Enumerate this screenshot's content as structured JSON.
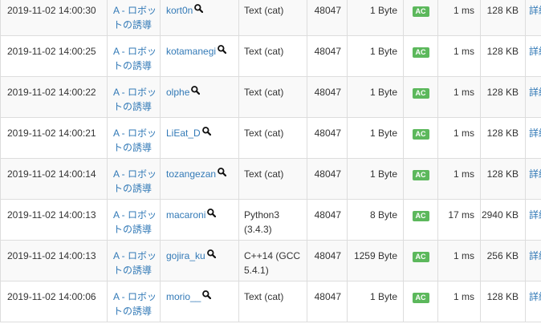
{
  "rows": [
    {
      "time": "2019-11-02 14:00:30",
      "task": "A - ロボットの誘導",
      "user": "kort0n",
      "lang": "Text (cat)",
      "score": "48047",
      "size": "1 Byte",
      "status": "AC",
      "exec": "1 ms",
      "memory": "128 KB",
      "detail": "詳細"
    },
    {
      "time": "2019-11-02 14:00:25",
      "task": "A - ロボットの誘導",
      "user": "kotamanegi",
      "lang": "Text (cat)",
      "score": "48047",
      "size": "1 Byte",
      "status": "AC",
      "exec": "1 ms",
      "memory": "128 KB",
      "detail": "詳細"
    },
    {
      "time": "2019-11-02 14:00:22",
      "task": "A - ロボットの誘導",
      "user": "olphe",
      "lang": "Text (cat)",
      "score": "48047",
      "size": "1 Byte",
      "status": "AC",
      "exec": "1 ms",
      "memory": "128 KB",
      "detail": "詳細"
    },
    {
      "time": "2019-11-02 14:00:21",
      "task": "A - ロボットの誘導",
      "user": "LiEat_D",
      "lang": "Text (cat)",
      "score": "48047",
      "size": "1 Byte",
      "status": "AC",
      "exec": "1 ms",
      "memory": "128 KB",
      "detail": "詳細"
    },
    {
      "time": "2019-11-02 14:00:14",
      "task": "A - ロボットの誘導",
      "user": "tozangezan",
      "lang": "Text (cat)",
      "score": "48047",
      "size": "1 Byte",
      "status": "AC",
      "exec": "1 ms",
      "memory": "128 KB",
      "detail": "詳細"
    },
    {
      "time": "2019-11-02 14:00:13",
      "task": "A - ロボットの誘導",
      "user": "macaroni",
      "lang": "Python3 (3.4.3)",
      "score": "48047",
      "size": "8 Byte",
      "status": "AC",
      "exec": "17 ms",
      "memory": "2940 KB",
      "detail": "詳細"
    },
    {
      "time": "2019-11-02 14:00:13",
      "task": "A - ロボットの誘導",
      "user": "gojira_ku",
      "lang": "C++14 (GCC 5.4.1)",
      "score": "48047",
      "size": "1259 Byte",
      "status": "AC",
      "exec": "1 ms",
      "memory": "256 KB",
      "detail": "詳細"
    },
    {
      "time": "2019-11-02 14:00:06",
      "task": "A - ロボットの誘導",
      "user": "morio__",
      "lang": "Text (cat)",
      "score": "48047",
      "size": "1 Byte",
      "status": "AC",
      "exec": "1 ms",
      "memory": "128 KB",
      "detail": "詳細"
    }
  ],
  "colors": {
    "accent_link": "#337ab7",
    "status_ac": "#5cb85c",
    "stripe": "#f9f9f9",
    "border": "#dddddd"
  },
  "icons": {
    "user_search": "magnifier-icon"
  }
}
